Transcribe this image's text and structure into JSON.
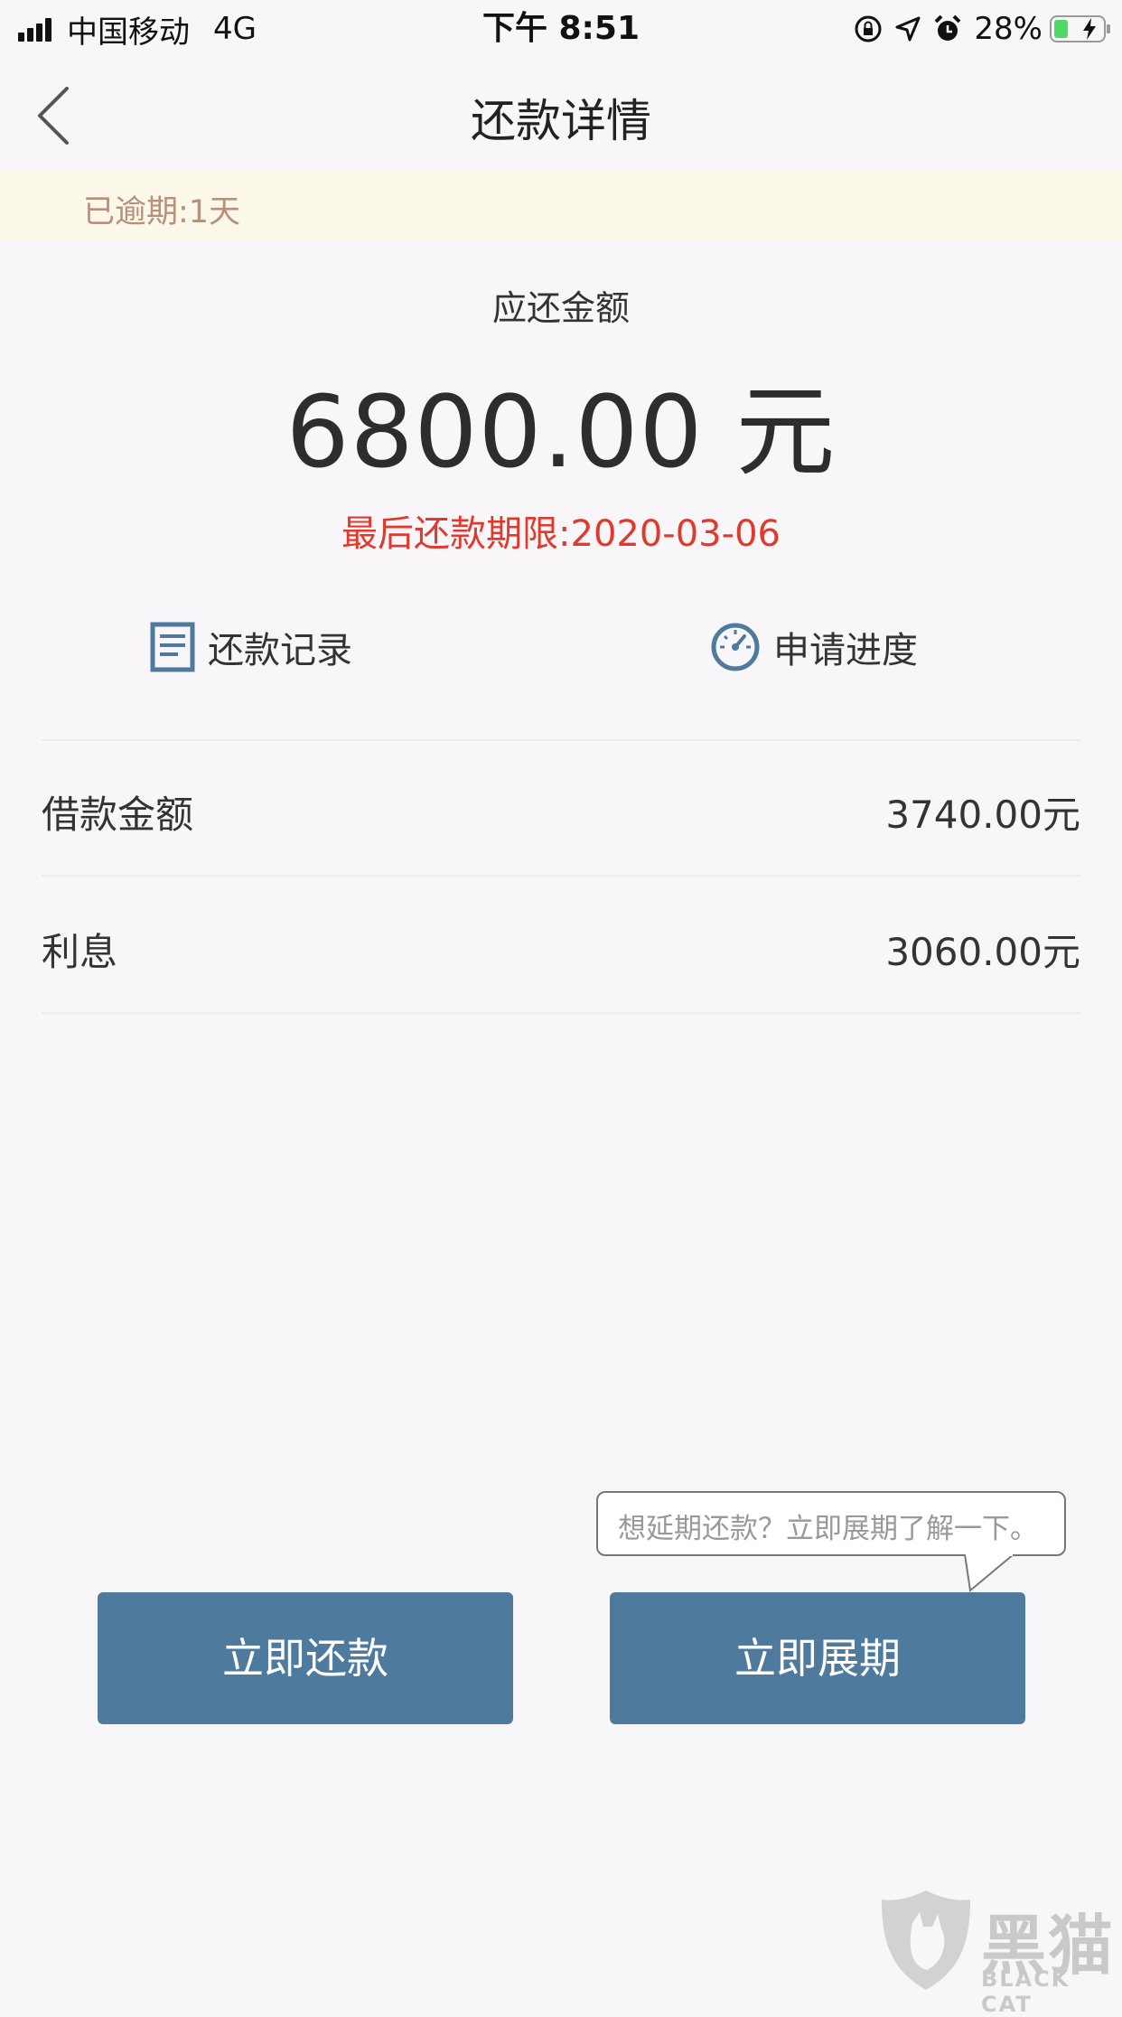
{
  "status_bar": {
    "carrier": "中国移动",
    "network": "4G",
    "time": "下午 8:51",
    "battery_percent": "28%",
    "battery_level": 0.28
  },
  "nav": {
    "title": "还款详情"
  },
  "overdue_banner": {
    "text": "已逾期:1天"
  },
  "summary": {
    "due_label": "应还金额",
    "due_amount": "6800.00 元",
    "deadline": "最后还款期限:2020-03-06"
  },
  "links": {
    "records": "还款记录",
    "progress": "申请进度"
  },
  "details": [
    {
      "label": "借款金额",
      "value": "3740.00元"
    },
    {
      "label": "利息",
      "value": "3060.00元"
    }
  ],
  "tooltip": {
    "text": "想延期还款？立即展期了解一下。"
  },
  "buttons": {
    "repay": "立即还款",
    "extend": "立即展期"
  },
  "watermark": {
    "zh": "黑猫",
    "en": "BLACK CAT"
  },
  "colors": {
    "button": "#4e7a9e",
    "deadline": "#e03a2f",
    "overdue_text": "#b98f7a",
    "overdue_bg": "#fbf7e9",
    "background": "#f8f6f8"
  }
}
